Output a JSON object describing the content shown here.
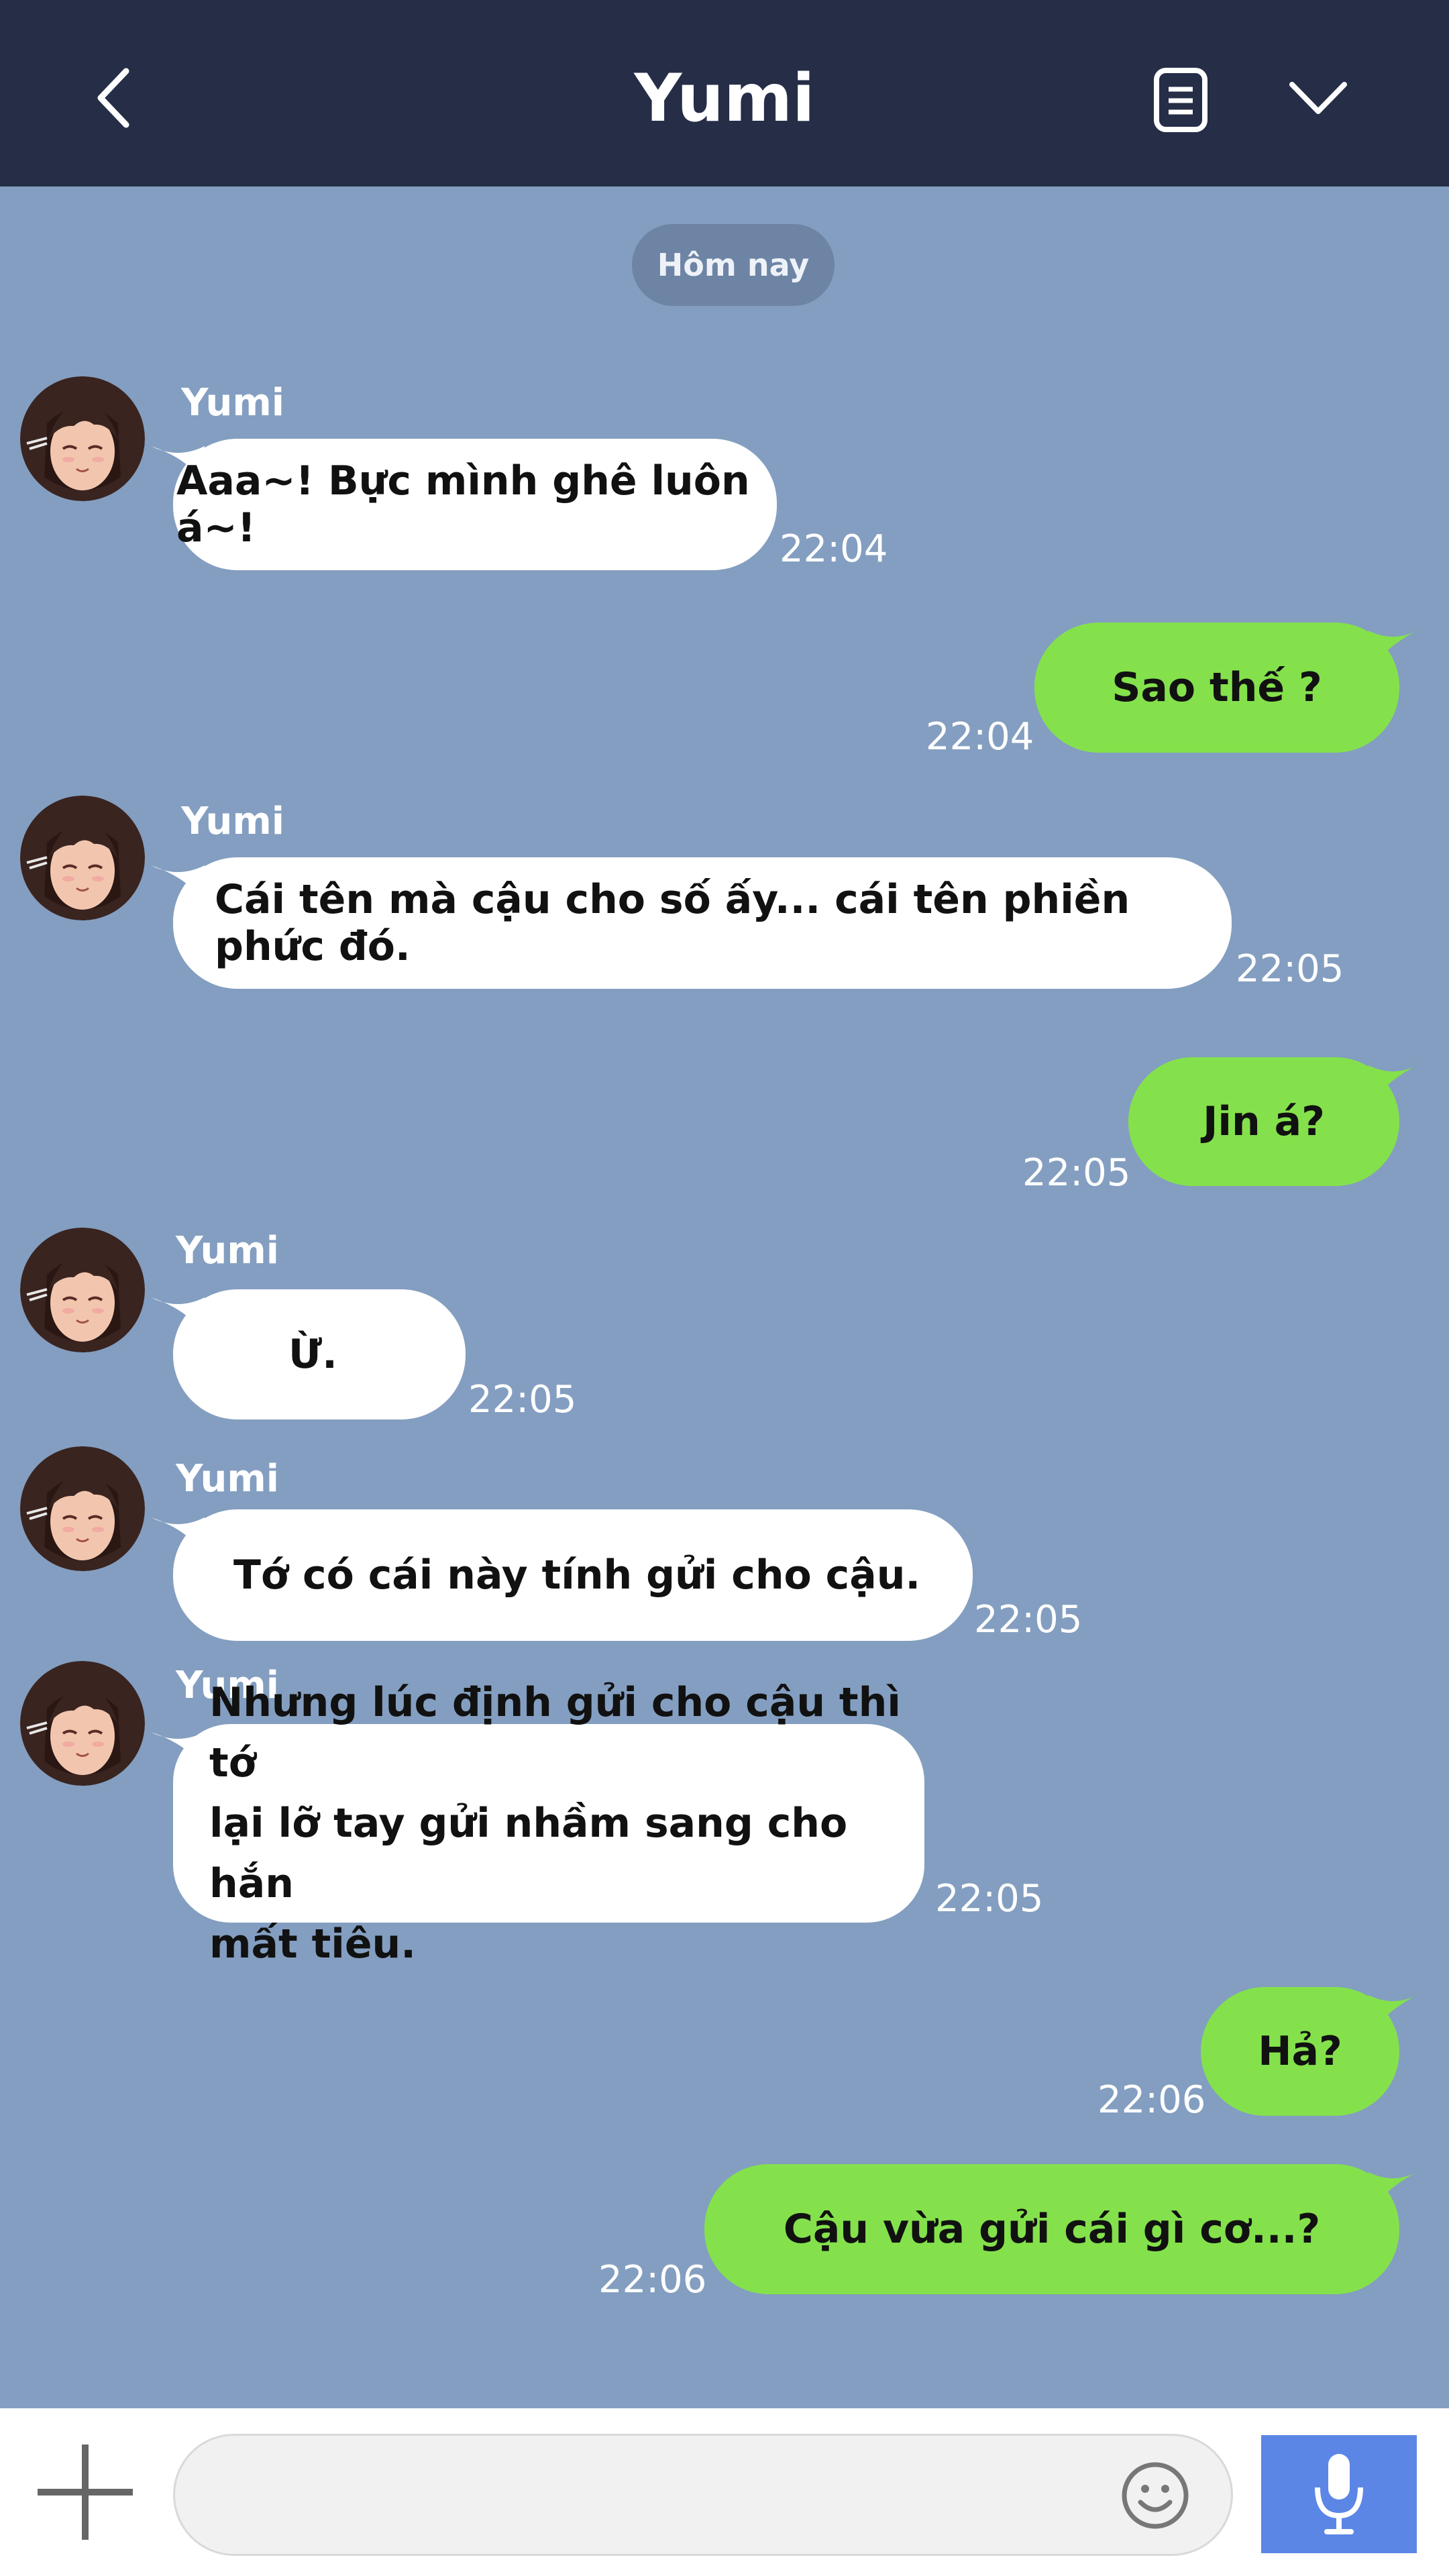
{
  "header": {
    "title": "Yumi",
    "icons": [
      "back-chevron-icon",
      "notes-icon",
      "dropdown-chevron-icon"
    ],
    "background": "#252d47"
  },
  "date_divider": "Hôm nay",
  "colors": {
    "chat_background": "#839ec0",
    "incoming_bubble": "#ffffff",
    "outgoing_bubble": "#84e14c",
    "mic_button": "#5b86e6"
  },
  "messages": [
    {
      "sender": "Yumi",
      "text": "Aaa~! Bực mình ghê luôn á~!",
      "time": "22:04",
      "direction": "incoming"
    },
    {
      "text": "Sao thế ?",
      "time": "22:04",
      "direction": "outgoing"
    },
    {
      "sender": "Yumi",
      "text": "Cái tên mà cậu cho số ấy... cái tên phiền phức đó.",
      "time": "22:05",
      "direction": "incoming"
    },
    {
      "text": "Jin á?",
      "time": "22:05",
      "direction": "outgoing"
    },
    {
      "sender": "Yumi",
      "text": "Ừ.",
      "time": "22:05",
      "direction": "incoming"
    },
    {
      "sender": "Yumi",
      "text": "Tớ có cái này tính gửi cho cậu.",
      "time": "22:05",
      "direction": "incoming"
    },
    {
      "sender": "Yumi",
      "lines": [
        "Nhưng lúc định gửi cho cậu thì tớ",
        "lại lỡ tay gửi nhầm sang cho hắn",
        "mất tiêu."
      ],
      "time": "22:05",
      "direction": "incoming"
    },
    {
      "text": "Hả?",
      "time": "22:06",
      "direction": "outgoing"
    },
    {
      "text": "Cậu vừa gửi cái gì cơ...?",
      "time": "22:06",
      "direction": "outgoing"
    }
  ],
  "input": {
    "placeholder": "",
    "icons": [
      "plus-icon",
      "emoji-icon",
      "microphone-icon"
    ]
  }
}
